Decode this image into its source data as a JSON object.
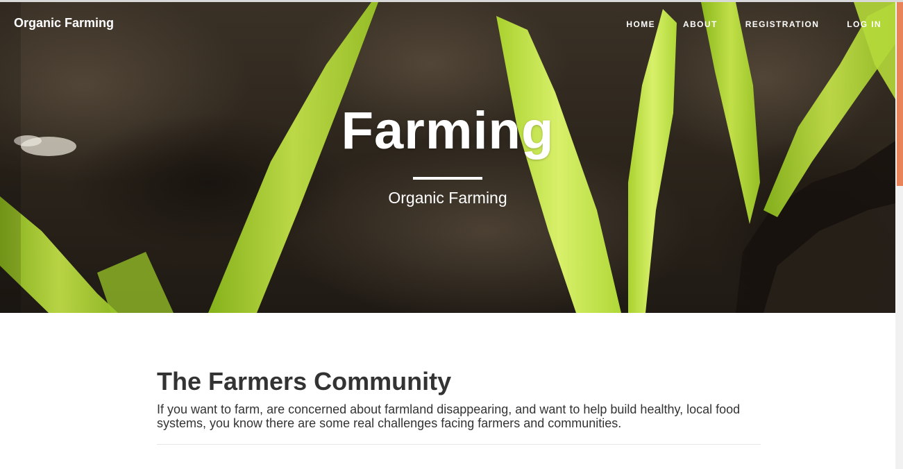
{
  "nav": {
    "brand": "Organic Farming",
    "links": [
      {
        "label": "HOME"
      },
      {
        "label": "ABOUT"
      },
      {
        "label": "REGISTRATION"
      },
      {
        "label": "LOG IN"
      }
    ]
  },
  "hero": {
    "title": "Farming",
    "subtitle": "Organic Farming"
  },
  "section": {
    "title": "The Farmers Community",
    "text": "If you want to farm, are concerned about farmland disappearing, and want to help build healthy, local food systems, you know there are some real challenges facing farmers and communities."
  },
  "colors": {
    "scrollbar_thumb": "#e8835a",
    "heading_text": "#333333",
    "hero_text": "#ffffff"
  }
}
